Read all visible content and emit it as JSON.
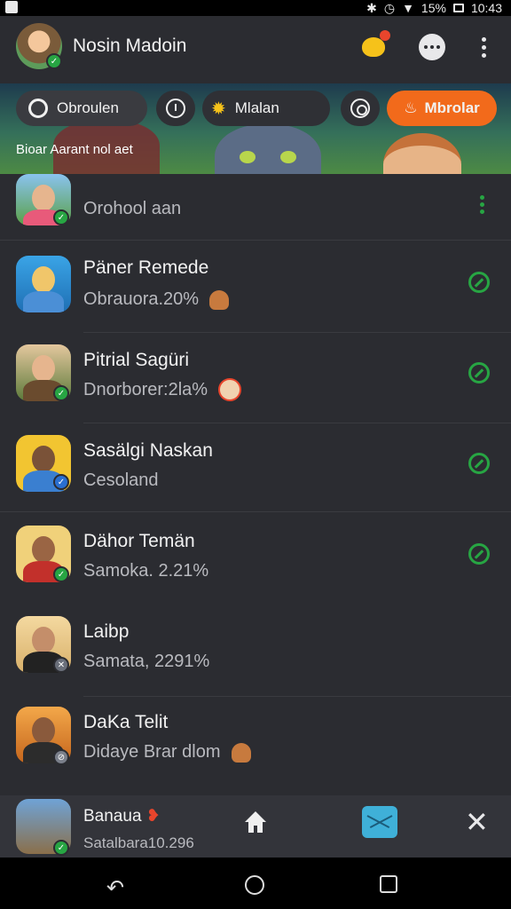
{
  "status_bar": {
    "left_icon": "notification-icon",
    "signal_text": "15%",
    "time": "10:43"
  },
  "header": {
    "title": "Nosin Madoin"
  },
  "filters": {
    "chip1": "Obroulen",
    "chip3": "Mlalan",
    "chip5": "Mbrolar",
    "caption": "Bioar Aarant nol aet"
  },
  "list": [
    {
      "name": "",
      "sub": "Orohool aan",
      "status": "more"
    },
    {
      "name": "Päner Remede",
      "sub": "Obrauora.20%",
      "status": "ok"
    },
    {
      "name": "Pitrial Sagüri",
      "sub": "Dnorborer:2la%",
      "status": "ok"
    },
    {
      "name": "Sasälgi Naskan",
      "sub": "Cesoland",
      "status": "ok"
    },
    {
      "name": "Dähor Temän",
      "sub": "Samoka. 2.21%",
      "status": "ok"
    },
    {
      "name": "Laibp",
      "sub": "Samata, 2291%",
      "status": "none"
    },
    {
      "name": "DaKa Telit",
      "sub": "Didaye Brar dlom",
      "status": "none"
    }
  ],
  "action_bar": {
    "name": "Banaua",
    "sub": "Satalbara10.296"
  },
  "colors": {
    "accent": "#f26a1b",
    "ok": "#27a543",
    "background": "#2b2c31"
  }
}
